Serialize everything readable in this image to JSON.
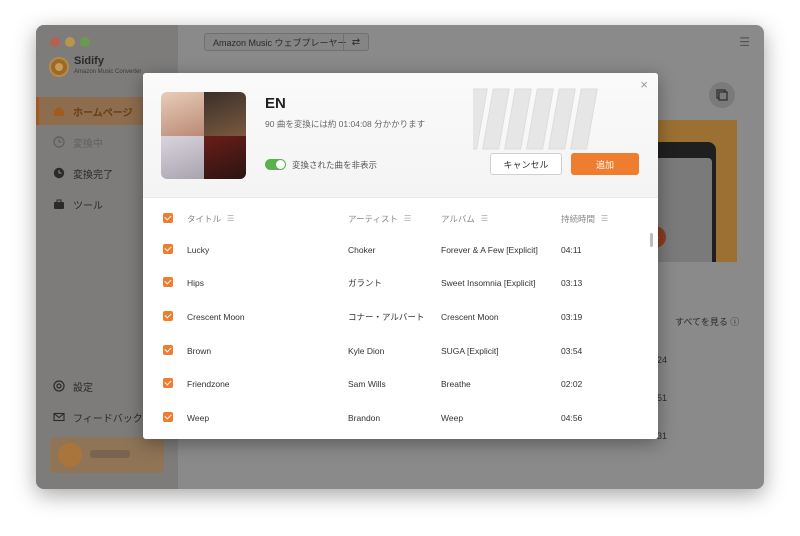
{
  "app": {
    "name": "Sidify",
    "subtitle": "Amazon Music Converter"
  },
  "sidebar": {
    "items": [
      {
        "label": "ホームページ",
        "icon": "home-icon",
        "state": "active"
      },
      {
        "label": "変換中",
        "icon": "clock-icon",
        "state": "disabled"
      },
      {
        "label": "変換完了",
        "icon": "clock-icon",
        "state": "normal"
      },
      {
        "label": "ツール",
        "icon": "toolbox-icon",
        "state": "normal"
      }
    ],
    "bottom": [
      {
        "label": "設定",
        "icon": "gear-icon"
      },
      {
        "label": "フィードバック",
        "icon": "mail-icon"
      }
    ]
  },
  "topbar": {
    "source": "Amazon Music ウェブプレーヤー",
    "switch_icon": "⇄",
    "menu_icon": "☰"
  },
  "main": {
    "see_all": "すべてを見る",
    "edge_numbers": [
      "24",
      "51",
      "31"
    ]
  },
  "modal": {
    "album_title": "EN",
    "info": "90 曲を変換には約 01:04:08 分かかります",
    "toggle_label": "変換された曲を非表示",
    "toggle_on": true,
    "cancel_label": "キャンセル",
    "add_label": "追加",
    "close_icon": "×",
    "columns": {
      "title": "タイトル",
      "artist": "アーティスト",
      "album": "アルバム",
      "duration": "持続時間"
    },
    "tracks": [
      {
        "title": "Lucky",
        "artist": "Choker",
        "album": "Forever & A Few [Explicit]",
        "duration": "04:11",
        "checked": true
      },
      {
        "title": "Hips",
        "artist": "ガラント",
        "album": "Sweet Insomnia [Explicit]",
        "duration": "03:13",
        "checked": true
      },
      {
        "title": "Crescent Moon",
        "artist": "コナー・アルバート",
        "album": "Crescent Moon",
        "duration": "03:19",
        "checked": true
      },
      {
        "title": "Brown",
        "artist": "Kyle Dion",
        "album": "SUGA [Explicit]",
        "duration": "03:54",
        "checked": true
      },
      {
        "title": "Friendzone",
        "artist": "Sam Wills",
        "album": "Breathe",
        "duration": "02:02",
        "checked": true
      },
      {
        "title": "Weep",
        "artist": "Brandon",
        "album": "Weep",
        "duration": "04:56",
        "checked": true
      }
    ]
  },
  "colors": {
    "accent": "#ee7d2f",
    "toggle_on": "#5ab04d"
  }
}
